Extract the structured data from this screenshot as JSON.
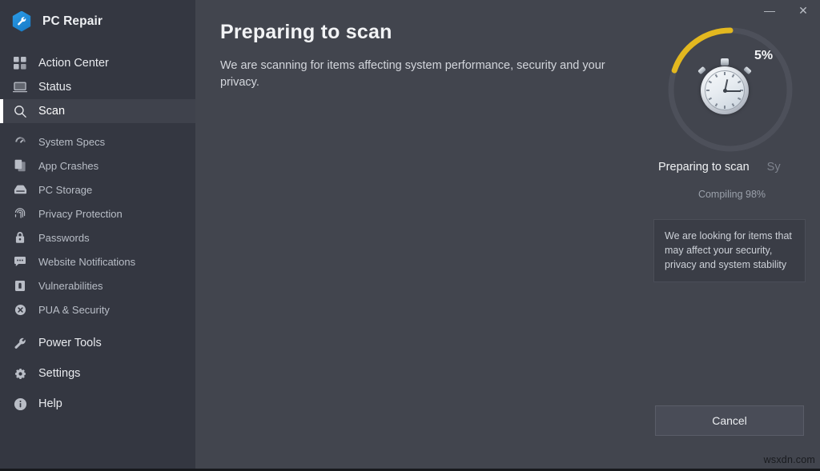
{
  "app": {
    "name": "PC Repair",
    "logo_icon": "wrench-hexagon-icon",
    "accent_color": "#1678c4"
  },
  "titlebar": {
    "minimize_label": "—",
    "close_label": "✕"
  },
  "sidebar": {
    "primary_items": [
      {
        "label": "Action Center",
        "icon": "grid-squares-icon",
        "selected": false
      },
      {
        "label": "Status",
        "icon": "monitor-icon",
        "selected": false
      },
      {
        "label": "Scan",
        "icon": "magnifier-icon",
        "selected": true
      }
    ],
    "sub_items": [
      {
        "label": "System Specs",
        "icon": "gauge-icon"
      },
      {
        "label": "App Crashes",
        "icon": "copy-pages-icon"
      },
      {
        "label": "PC Storage",
        "icon": "hard-drive-icon"
      },
      {
        "label": "Privacy Protection",
        "icon": "fingerprint-icon"
      },
      {
        "label": "Passwords",
        "icon": "padlock-icon"
      },
      {
        "label": "Website Notifications",
        "icon": "chat-bubble-icon"
      },
      {
        "label": "Vulnerabilities",
        "icon": "shield-alert-icon"
      },
      {
        "label": "PUA & Security",
        "icon": "circle-x-icon"
      }
    ],
    "footer_items": [
      {
        "label": "Power Tools",
        "icon": "wrench-icon"
      },
      {
        "label": "Settings",
        "icon": "gear-icon"
      },
      {
        "label": "Help",
        "icon": "info-circle-icon"
      }
    ]
  },
  "main": {
    "title": "Preparing to scan",
    "subtitle": "We are scanning for items affecting system performance, security and your privacy.",
    "progress": {
      "percent_label": "5%",
      "percent_value": 5,
      "ring_color": "#e3b81f",
      "ring_track_color": "#4d505a",
      "center_icon": "stopwatch-icon"
    },
    "status": {
      "current": "Preparing to scan",
      "next": "Sy",
      "sub": "Compiling 98%"
    },
    "info_box": {
      "text": "We are looking for items that may affect your security, privacy and system stability"
    },
    "cancel_label": "Cancel"
  },
  "watermark": {
    "text": "wsxdn.com"
  }
}
